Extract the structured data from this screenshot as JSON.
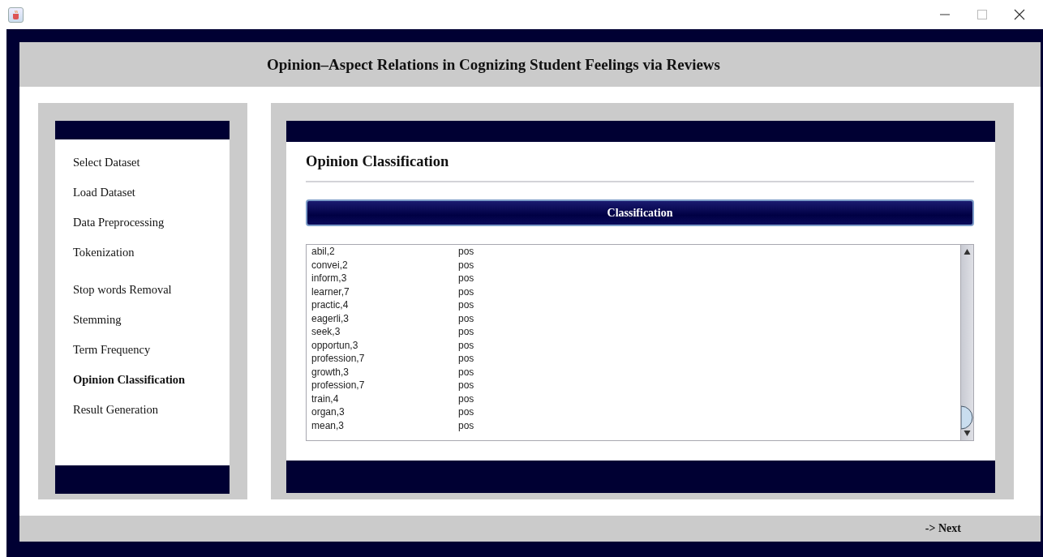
{
  "header": {
    "title": "Opinion–Aspect Relations in Cognizing Student Feelings via Reviews"
  },
  "sidebar": {
    "items": [
      {
        "label": "Select Dataset",
        "selected": false
      },
      {
        "label": "Load Dataset",
        "selected": false
      },
      {
        "label": "Data Preprocessing",
        "selected": false
      },
      {
        "label": "Tokenization",
        "selected": false
      },
      {
        "label": "Stop words Removal",
        "selected": false
      },
      {
        "label": "Stemming",
        "selected": false
      },
      {
        "label": "Term Frequency",
        "selected": false
      },
      {
        "label": "Opinion Classification",
        "selected": true
      },
      {
        "label": "Result Generation",
        "selected": false
      }
    ]
  },
  "content": {
    "title": "Opinion Classification",
    "button": "Classification",
    "rows": [
      [
        "abil,2",
        "pos"
      ],
      [
        "convei,2",
        "pos"
      ],
      [
        "inform,3",
        "pos"
      ],
      [
        "learner,7",
        "pos"
      ],
      [
        "practic,4",
        "pos"
      ],
      [
        "eagerli,3",
        "pos"
      ],
      [
        "seek,3",
        "pos"
      ],
      [
        "opportun,3",
        "pos"
      ],
      [
        "profession,7",
        "pos"
      ],
      [
        "growth,3",
        "pos"
      ],
      [
        "profession,7",
        "pos"
      ],
      [
        "train,4",
        "pos"
      ],
      [
        "organ,3",
        "pos"
      ],
      [
        "mean,3",
        "pos"
      ]
    ]
  },
  "footer": {
    "next": "-> Next"
  }
}
